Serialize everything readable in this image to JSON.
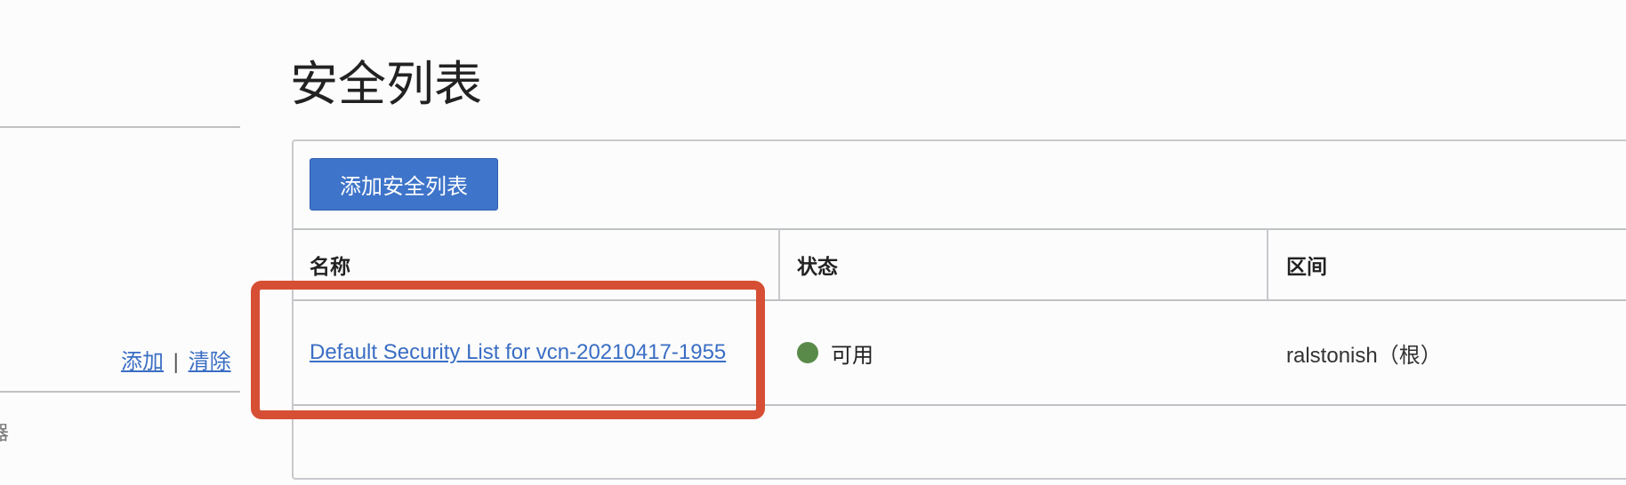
{
  "sidebar": {
    "add_link": "添加",
    "separator": "|",
    "clear_link": "清除",
    "truncated_text": "器"
  },
  "page": {
    "title": "安全列表"
  },
  "toolbar": {
    "add_button": "添加安全列表"
  },
  "table": {
    "columns": [
      "名称",
      "状态",
      "区间"
    ],
    "rows": [
      {
        "name": "Default Security List for vcn-20210417-1955",
        "status": "可用",
        "compartment": "ralstonish（根）"
      }
    ]
  },
  "colors": {
    "status_available": "#5a8a4a",
    "highlight": "#d64f35",
    "primary": "#3e74c9"
  }
}
